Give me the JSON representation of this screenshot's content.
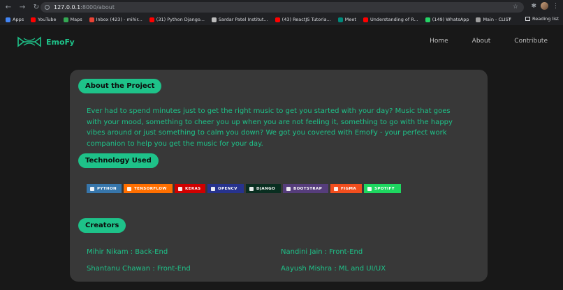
{
  "browser": {
    "url_host": "127.0.0.1",
    "url_path": ":8000/about",
    "bookmarks": [
      {
        "label": "Apps",
        "color": "#4285f4"
      },
      {
        "label": "YouTube",
        "color": "#ff0000"
      },
      {
        "label": "Maps",
        "color": "#34a853"
      },
      {
        "label": "Inbox (423) - mihir...",
        "color": "#ea4335"
      },
      {
        "label": "(31) Python Django...",
        "color": "#ff0000"
      },
      {
        "label": "Sardar Patel Institut...",
        "color": "#bbbbbb"
      },
      {
        "label": "(43) ReactJS Tutoria...",
        "color": "#ff0000"
      },
      {
        "label": "Meet",
        "color": "#00897b"
      },
      {
        "label": "Understanding of R...",
        "color": "#ff0000"
      },
      {
        "label": "(149) WhatsApp",
        "color": "#25d366"
      },
      {
        "label": "Main - CLIST",
        "color": "#9e9e9e"
      }
    ],
    "more": "»",
    "reading_list": "Reading list"
  },
  "site": {
    "brand": "EmoFy",
    "nav": [
      "Home",
      "About",
      "Contribute"
    ],
    "about_heading": "About the Project",
    "about_text": "Ever had to spend minutes just to get the right music to get you started with your day? Music that goes with your mood, something to cheer you up when you are not feeling it, something to go with the happy vibes around or just something to calm you down? We got you covered with EmoFy - your perfect work companion to help you get the music for your day.",
    "tech_heading": "Technology Used",
    "badges": [
      {
        "label": "PYTHON",
        "color": "#3776ab",
        "width": 50
      },
      {
        "label": "TENSORFLOW",
        "color": "#ff6f00",
        "width": 70
      },
      {
        "label": "KERAS",
        "color": "#d00000",
        "width": 44
      },
      {
        "label": "OPENCV",
        "color": "#27338e",
        "width": 52
      },
      {
        "label": "DJANGO",
        "color": "#092e20",
        "width": 50
      },
      {
        "label": "BOOTSTRAP",
        "color": "#563d7c",
        "width": 65
      },
      {
        "label": "FIGMA",
        "color": "#f24e1e",
        "width": 45
      },
      {
        "label": "SPOTIFY",
        "color": "#1ed760",
        "width": 53
      }
    ],
    "creators_heading": "Creators",
    "creators": [
      "Mihir Nikam : Back-End",
      "Nandini Jain : Front-End",
      "Shantanu Chawan : Front-End",
      "Aayush Mishra : ML and UI/UX"
    ],
    "accent": "#1ec289"
  }
}
